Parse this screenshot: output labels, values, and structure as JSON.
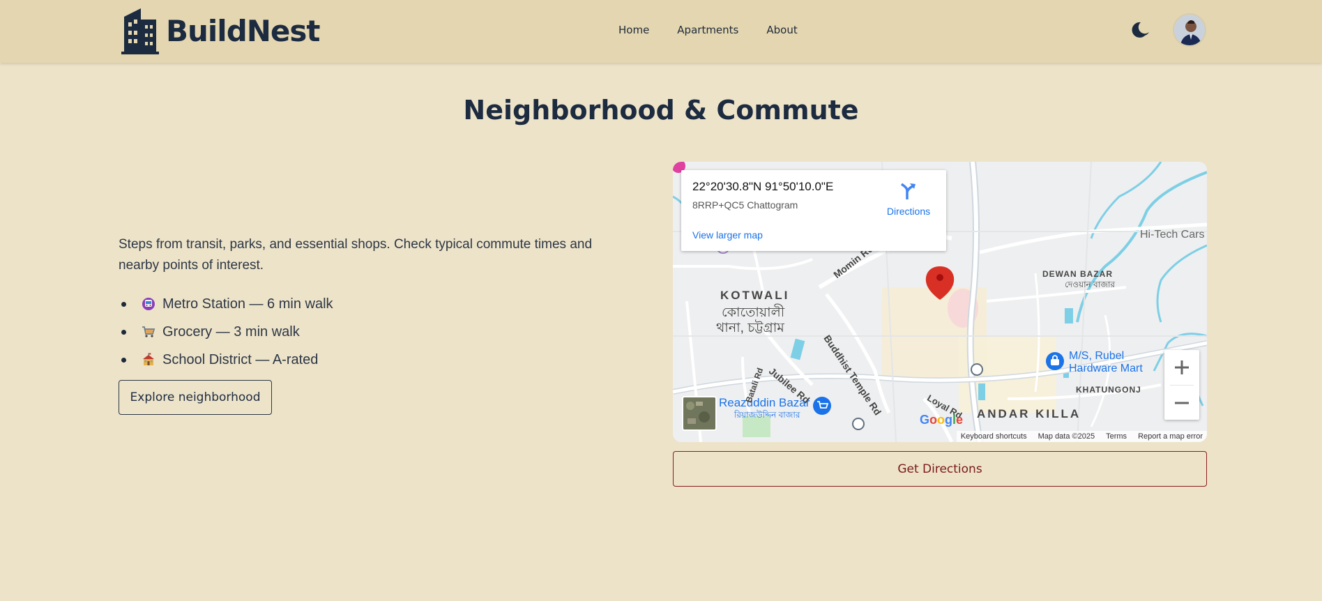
{
  "brand": {
    "name": "BuildNest"
  },
  "nav": {
    "items": [
      "Home",
      "Apartments",
      "About"
    ]
  },
  "header": {
    "theme_icon": "moon-icon",
    "avatar_icon": "user-avatar"
  },
  "main": {
    "title": "Neighborhood & Commute",
    "intro": "Steps from transit, parks, and essential shops. Check typical commute times and nearby points of interest.",
    "features": [
      {
        "icon": "metro-icon",
        "label": "Metro Station — 6 min walk"
      },
      {
        "icon": "cart-icon",
        "label": "Grocery — 3 min walk"
      },
      {
        "icon": "school-icon",
        "label": "School District — A-rated"
      }
    ],
    "explore_label": "Explore neighborhood",
    "get_directions_label": "Get Directions"
  },
  "map": {
    "coords": "22°20'30.8\"N 91°50'10.0\"E",
    "plus_code": "8RRP+QC5 Chattogram",
    "directions_label": "Directions",
    "larger_map_label": "View larger map",
    "attribution": {
      "shortcuts": "Keyboard shortcuts",
      "data": "Map data ©2025",
      "terms": "Terms",
      "report": "Report a map error"
    },
    "google_logo": "Google",
    "labels": {
      "kotwali": "KOTWALI",
      "kotwali_bn1": "কোতোয়ালী",
      "kotwali_bn2": "থানা, চট্টগ্রাম",
      "dewan_bazar": "DEWAN BAZAR",
      "dewan_bazar_bn": "দেওয়ান বাজার",
      "khatungonj": "KHATUNGONJ",
      "andar_killa": "ANDAR KILLA",
      "hitech": "Hi-Tech Cars",
      "rubel1": "M/S, Rubel",
      "rubel2": "Hardware Mart",
      "reazuddin": "Reazuddin Bazar",
      "reazuddin_bn": "রিয়াজউদ্দিন বাজার",
      "momin_rd": "Momin Rd",
      "buddhist_rd": "Buddhist Temple Rd",
      "jubilee_rd": "Jubilee Rd",
      "batali_rd": "Batali Rd",
      "loyal_rd": "Loyal Rd"
    },
    "colors": {
      "water": "#7dcfe6",
      "roads": "#ffffff",
      "marker": "#d93025",
      "land": "#eeeff0"
    }
  },
  "colors": {
    "background": "#ede3c9",
    "navbar": "#e4d6b0",
    "text_dark": "#1c2b40",
    "accent_red": "#7a1a1a"
  }
}
